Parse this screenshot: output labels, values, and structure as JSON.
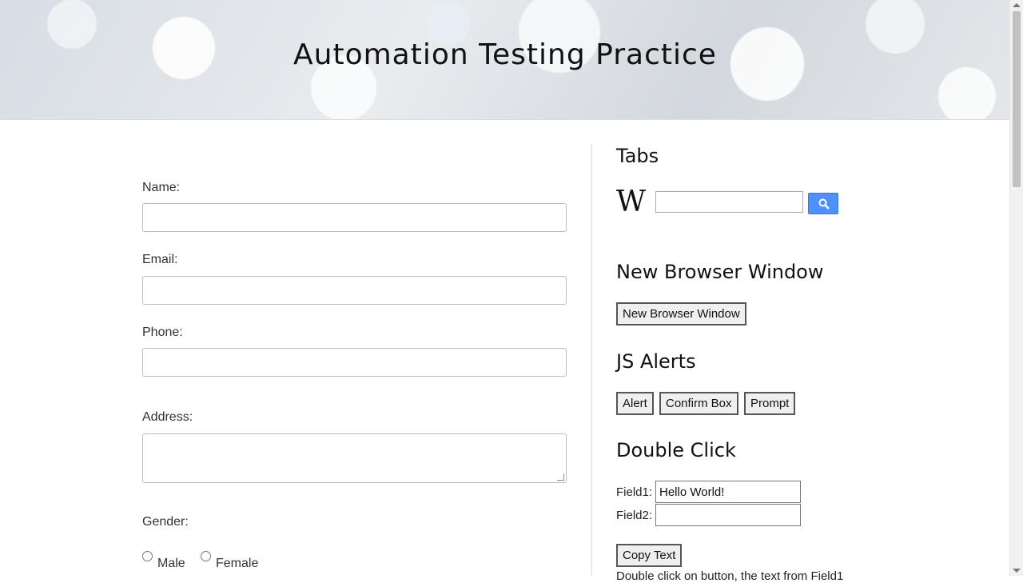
{
  "header": {
    "title": "Automation Testing Practice"
  },
  "form": {
    "name_label": "Name:",
    "email_label": "Email:",
    "phone_label": "Phone:",
    "address_label": "Address:",
    "gender_label": "Gender:",
    "gender_options": [
      "Male",
      "Female"
    ]
  },
  "tabs": {
    "heading": "Tabs",
    "wiki_logo": "W",
    "search_icon": "search-icon",
    "search_button_color": "#4d90fe"
  },
  "new_window": {
    "heading": "New Browser Window",
    "button": "New Browser Window"
  },
  "alerts": {
    "heading": "JS Alerts",
    "buttons": [
      "Alert",
      "Confirm Box",
      "Prompt"
    ]
  },
  "double_click": {
    "heading": "Double Click",
    "field1_label": "Field1:",
    "field1_value": "Hello World!",
    "field2_label": "Field2:",
    "field2_value": "",
    "button": "Copy Text",
    "note": "Double click on button, the text from Field1"
  }
}
